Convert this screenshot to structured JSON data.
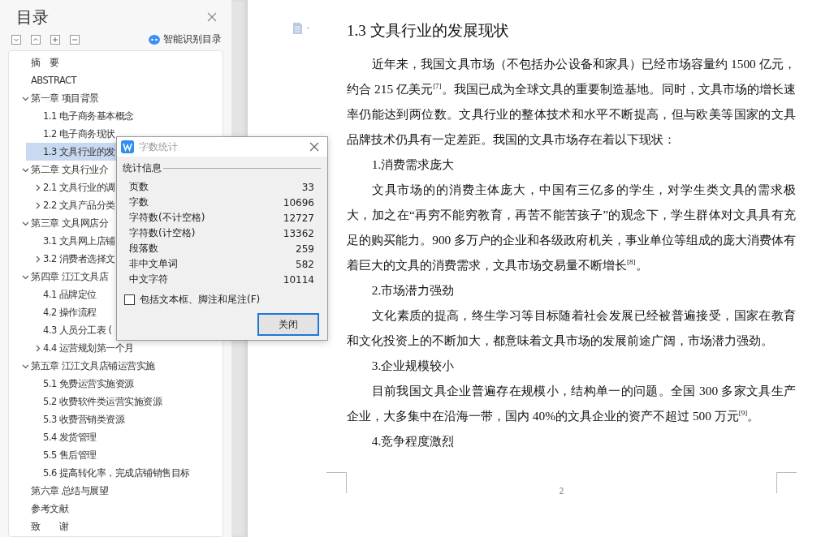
{
  "toc_panel": {
    "title": "目录",
    "smart_button": "智能识别目录",
    "items": [
      {
        "label": "摘　要",
        "selected": false
      },
      {
        "label": "ABSTRACT",
        "selected": false
      },
      {
        "label": "第一章  项目背景",
        "selected": false,
        "expanded": true,
        "children": [
          {
            "label": "1.1 电子商务基本概念",
            "selected": false
          },
          {
            "label": "1.2 电子商务现状",
            "selected": false
          },
          {
            "label": "1.3 文具行业的发",
            "selected": true
          }
        ]
      },
      {
        "label": "第二章  文具行业介",
        "selected": false,
        "expanded": true,
        "children": [
          {
            "label": "2.1 文具行业的调",
            "selected": false,
            "expanded": false
          },
          {
            "label": "2.2 文具产品分类",
            "selected": false,
            "expanded": false
          }
        ]
      },
      {
        "label": "第三章  文具网店分",
        "selected": false,
        "expanded": true,
        "children": [
          {
            "label": "3.1 文具网上店铺",
            "selected": false
          },
          {
            "label": "3.2 消费者选择文",
            "selected": false,
            "expanded": false
          }
        ]
      },
      {
        "label": "第四章  江江文具店",
        "selected": false,
        "expanded": true,
        "children": [
          {
            "label": "4.1 品牌定位",
            "selected": false
          },
          {
            "label": "4.2 操作流程",
            "selected": false
          },
          {
            "label": "4.3 人员分工表 (",
            "selected": false
          },
          {
            "label": "4.4 运营规划第一个月",
            "selected": false,
            "expanded": false
          }
        ]
      },
      {
        "label": "第五章  江江文具店铺运营实施",
        "selected": false,
        "expanded": true,
        "children": [
          {
            "label": "5.1 免费运营实施资源",
            "selected": false
          },
          {
            "label": "5.2 收费软件类运营实施资源",
            "selected": false
          },
          {
            "label": "5.3 收费营销类资源",
            "selected": false
          },
          {
            "label": "5.4 发货管理",
            "selected": false
          },
          {
            "label": "5.5 售后管理",
            "selected": false
          },
          {
            "label": "5.6 提高转化率，完成店铺销售目标",
            "selected": false
          }
        ]
      },
      {
        "label": "第六章  总结与展望",
        "selected": false
      },
      {
        "label": "参考文献",
        "selected": false
      },
      {
        "label": "致　　谢",
        "selected": false
      }
    ]
  },
  "document": {
    "heading": "1.3 文具行业的发展现状",
    "blocks": [
      {
        "kind": "paragraph",
        "text": "近年来，我国文具市场（不包括办公设备和家具）已经市场容量约 1500 亿元，约合 215 亿美元$^{[7]}$。我国已成为全球文具的重要制造基地。同时，文具市场的增长速率仍能达到两位数。文具行业的整体技术和水平不断提高，但与欧美等国家的文具品牌技术仍具有一定差距。我国的文具市场存在着以下现状："
      },
      {
        "kind": "subheading",
        "text": "1.消费需求庞大"
      },
      {
        "kind": "paragraph",
        "text": "文具市场的的消费主体庞大，中国有三亿多的学生，对学生类文具的需求极大，加之在“再穷不能穷教育，再苦不能苦孩子”的观念下，学生群体对文具具有充足的购买能力。900 多万户的企业和各级政府机关，事业单位等组成的庞大消费体有着巨大的文具的消费需求，文具市场交易量不断增长$^{[8]}$。"
      },
      {
        "kind": "subheading",
        "text": "2.市场潜力强劲"
      },
      {
        "kind": "paragraph",
        "text": "文化素质的提高，终生学习等目标随着社会发展已经被普遍接受，国家在教育和文化投资上的不断加大，都意味着文具市场的发展前途广阔，市场潜力强劲。"
      },
      {
        "kind": "subheading",
        "text": "3.企业规模较小"
      },
      {
        "kind": "paragraph",
        "text": "目前我国文具企业普遍存在规模小，结构单一的问题。全国 300 多家文具生产企业，大多集中在沿海一带，国内 40%的文具企业的资产不超过 500 万元$^{[9]}$。"
      },
      {
        "kind": "subheading",
        "text": "4.竞争程度激烈"
      }
    ],
    "page_number": "2"
  },
  "dialog": {
    "title": "字数统计",
    "group": "统计信息",
    "stats": [
      {
        "label": "页数",
        "value": "33"
      },
      {
        "label": "字数",
        "value": "10696"
      },
      {
        "label": "字符数(不计空格)",
        "value": "12727"
      },
      {
        "label": "字符数(计空格)",
        "value": "13362"
      },
      {
        "label": "段落数",
        "value": "259"
      },
      {
        "label": "非中文单词",
        "value": "582"
      },
      {
        "label": "中文字符",
        "value": "10114"
      }
    ],
    "checkbox": {
      "label": "包括文本框、脚注和尾注(F)",
      "checked": false
    },
    "button": "关闭"
  }
}
